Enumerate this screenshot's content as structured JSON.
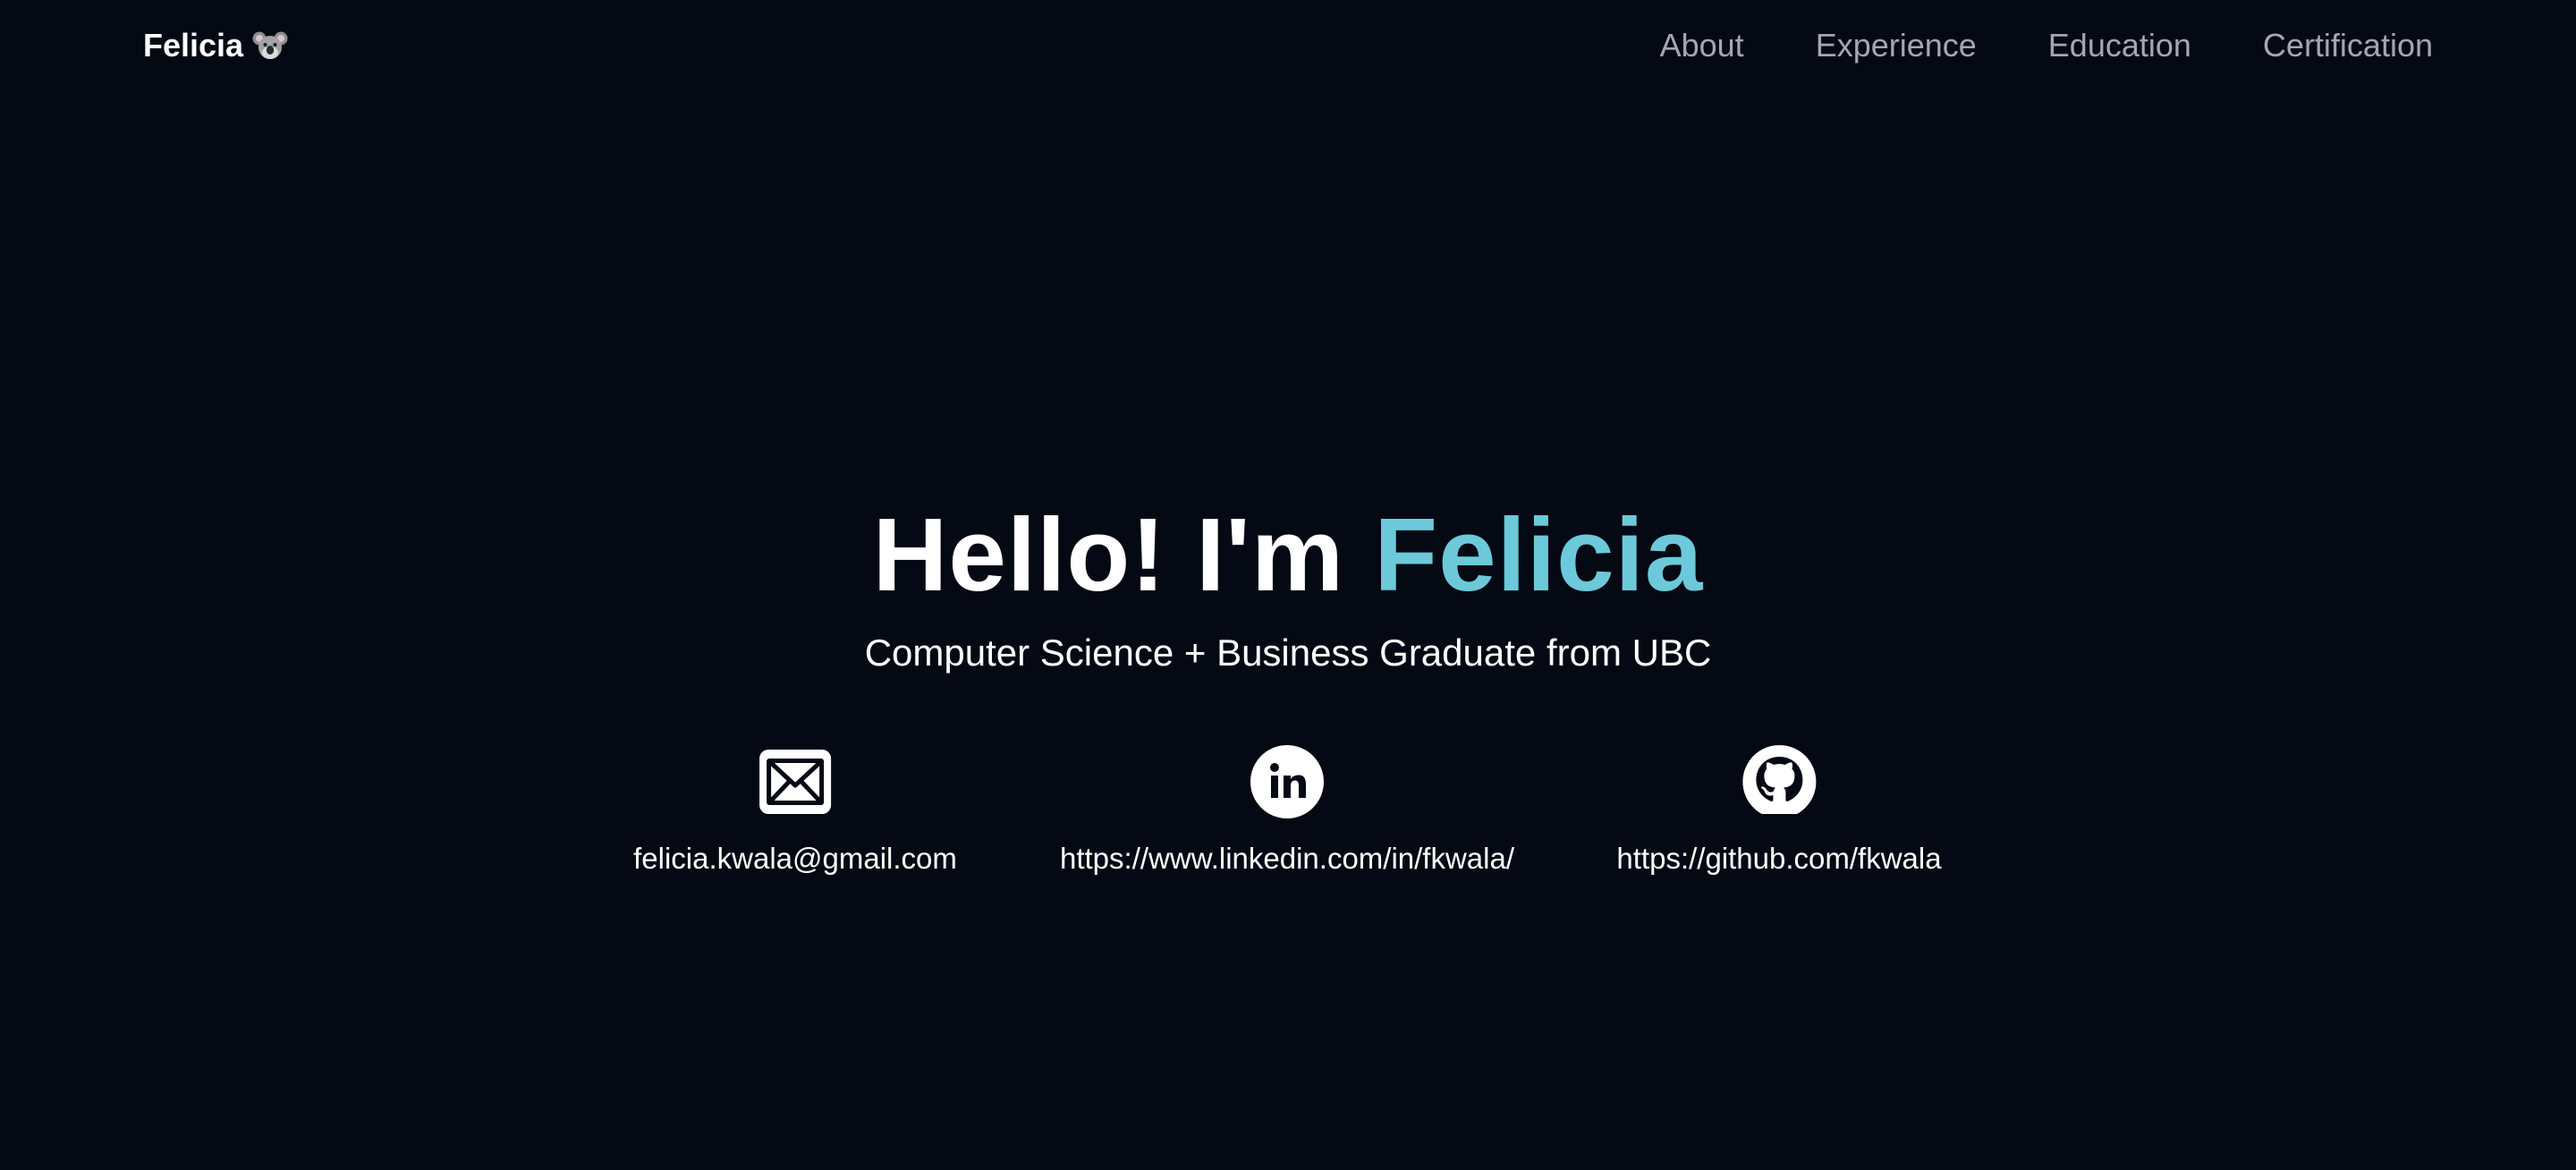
{
  "nav": {
    "brand": "Felicia",
    "brand_icon": "koala-icon",
    "links": [
      {
        "label": "About"
      },
      {
        "label": "Experience"
      },
      {
        "label": "Education"
      },
      {
        "label": "Certification"
      }
    ]
  },
  "hero": {
    "greeting": "Hello! I'm ",
    "name": "Felicia",
    "subtitle": "Computer Science + Business Graduate from UBC",
    "name_color": "#6cc9d9"
  },
  "contacts": [
    {
      "icon": "mail-icon",
      "text": "felicia.kwala@gmail.com"
    },
    {
      "icon": "linkedin-icon",
      "text": "https://www.linkedin.com/in/fkwala/"
    },
    {
      "icon": "github-icon",
      "text": "https://github.com/fkwala"
    }
  ],
  "colors": {
    "background": "#050914",
    "nav_link": "#a3a6b5",
    "accent": "#6cc9d9"
  }
}
